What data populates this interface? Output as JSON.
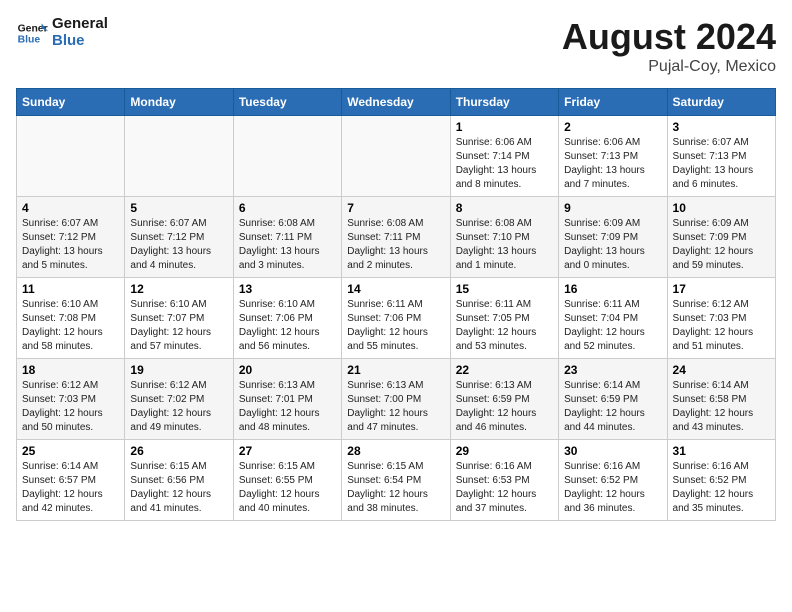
{
  "header": {
    "logo_line1": "General",
    "logo_line2": "Blue",
    "month_year": "August 2024",
    "location": "Pujal-Coy, Mexico"
  },
  "days_of_week": [
    "Sunday",
    "Monday",
    "Tuesday",
    "Wednesday",
    "Thursday",
    "Friday",
    "Saturday"
  ],
  "weeks": [
    [
      {
        "day": "",
        "info": ""
      },
      {
        "day": "",
        "info": ""
      },
      {
        "day": "",
        "info": ""
      },
      {
        "day": "",
        "info": ""
      },
      {
        "day": "1",
        "info": "Sunrise: 6:06 AM\nSunset: 7:14 PM\nDaylight: 13 hours and 8 minutes."
      },
      {
        "day": "2",
        "info": "Sunrise: 6:06 AM\nSunset: 7:13 PM\nDaylight: 13 hours and 7 minutes."
      },
      {
        "day": "3",
        "info": "Sunrise: 6:07 AM\nSunset: 7:13 PM\nDaylight: 13 hours and 6 minutes."
      }
    ],
    [
      {
        "day": "4",
        "info": "Sunrise: 6:07 AM\nSunset: 7:12 PM\nDaylight: 13 hours and 5 minutes."
      },
      {
        "day": "5",
        "info": "Sunrise: 6:07 AM\nSunset: 7:12 PM\nDaylight: 13 hours and 4 minutes."
      },
      {
        "day": "6",
        "info": "Sunrise: 6:08 AM\nSunset: 7:11 PM\nDaylight: 13 hours and 3 minutes."
      },
      {
        "day": "7",
        "info": "Sunrise: 6:08 AM\nSunset: 7:11 PM\nDaylight: 13 hours and 2 minutes."
      },
      {
        "day": "8",
        "info": "Sunrise: 6:08 AM\nSunset: 7:10 PM\nDaylight: 13 hours and 1 minute."
      },
      {
        "day": "9",
        "info": "Sunrise: 6:09 AM\nSunset: 7:09 PM\nDaylight: 13 hours and 0 minutes."
      },
      {
        "day": "10",
        "info": "Sunrise: 6:09 AM\nSunset: 7:09 PM\nDaylight: 12 hours and 59 minutes."
      }
    ],
    [
      {
        "day": "11",
        "info": "Sunrise: 6:10 AM\nSunset: 7:08 PM\nDaylight: 12 hours and 58 minutes."
      },
      {
        "day": "12",
        "info": "Sunrise: 6:10 AM\nSunset: 7:07 PM\nDaylight: 12 hours and 57 minutes."
      },
      {
        "day": "13",
        "info": "Sunrise: 6:10 AM\nSunset: 7:06 PM\nDaylight: 12 hours and 56 minutes."
      },
      {
        "day": "14",
        "info": "Sunrise: 6:11 AM\nSunset: 7:06 PM\nDaylight: 12 hours and 55 minutes."
      },
      {
        "day": "15",
        "info": "Sunrise: 6:11 AM\nSunset: 7:05 PM\nDaylight: 12 hours and 53 minutes."
      },
      {
        "day": "16",
        "info": "Sunrise: 6:11 AM\nSunset: 7:04 PM\nDaylight: 12 hours and 52 minutes."
      },
      {
        "day": "17",
        "info": "Sunrise: 6:12 AM\nSunset: 7:03 PM\nDaylight: 12 hours and 51 minutes."
      }
    ],
    [
      {
        "day": "18",
        "info": "Sunrise: 6:12 AM\nSunset: 7:03 PM\nDaylight: 12 hours and 50 minutes."
      },
      {
        "day": "19",
        "info": "Sunrise: 6:12 AM\nSunset: 7:02 PM\nDaylight: 12 hours and 49 minutes."
      },
      {
        "day": "20",
        "info": "Sunrise: 6:13 AM\nSunset: 7:01 PM\nDaylight: 12 hours and 48 minutes."
      },
      {
        "day": "21",
        "info": "Sunrise: 6:13 AM\nSunset: 7:00 PM\nDaylight: 12 hours and 47 minutes."
      },
      {
        "day": "22",
        "info": "Sunrise: 6:13 AM\nSunset: 6:59 PM\nDaylight: 12 hours and 46 minutes."
      },
      {
        "day": "23",
        "info": "Sunrise: 6:14 AM\nSunset: 6:59 PM\nDaylight: 12 hours and 44 minutes."
      },
      {
        "day": "24",
        "info": "Sunrise: 6:14 AM\nSunset: 6:58 PM\nDaylight: 12 hours and 43 minutes."
      }
    ],
    [
      {
        "day": "25",
        "info": "Sunrise: 6:14 AM\nSunset: 6:57 PM\nDaylight: 12 hours and 42 minutes."
      },
      {
        "day": "26",
        "info": "Sunrise: 6:15 AM\nSunset: 6:56 PM\nDaylight: 12 hours and 41 minutes."
      },
      {
        "day": "27",
        "info": "Sunrise: 6:15 AM\nSunset: 6:55 PM\nDaylight: 12 hours and 40 minutes."
      },
      {
        "day": "28",
        "info": "Sunrise: 6:15 AM\nSunset: 6:54 PM\nDaylight: 12 hours and 38 minutes."
      },
      {
        "day": "29",
        "info": "Sunrise: 6:16 AM\nSunset: 6:53 PM\nDaylight: 12 hours and 37 minutes."
      },
      {
        "day": "30",
        "info": "Sunrise: 6:16 AM\nSunset: 6:52 PM\nDaylight: 12 hours and 36 minutes."
      },
      {
        "day": "31",
        "info": "Sunrise: 6:16 AM\nSunset: 6:52 PM\nDaylight: 12 hours and 35 minutes."
      }
    ]
  ]
}
